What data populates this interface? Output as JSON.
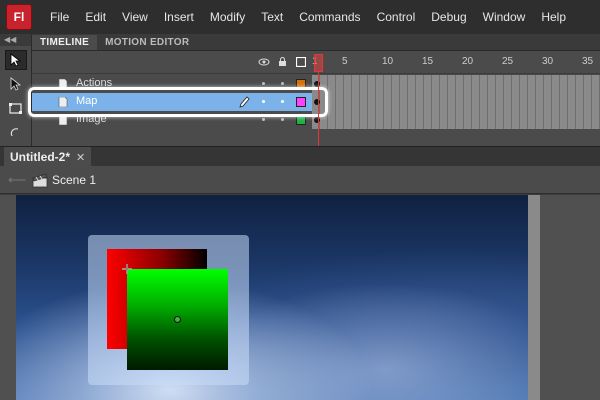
{
  "app": {
    "logo_text": "Fl"
  },
  "menu": [
    "File",
    "Edit",
    "View",
    "Insert",
    "Modify",
    "Text",
    "Commands",
    "Control",
    "Debug",
    "Window",
    "Help"
  ],
  "timeline": {
    "tabs": [
      {
        "label": "TIMELINE",
        "active": true
      },
      {
        "label": "MOTION EDITOR",
        "active": false
      }
    ],
    "frame_numbers": [
      "1",
      "5",
      "10",
      "15",
      "20",
      "25",
      "30",
      "35"
    ],
    "layers": [
      {
        "name": "Actions",
        "color": "#d4700a",
        "selected": false
      },
      {
        "name": "Map",
        "color": "#ff40ff",
        "selected": true
      },
      {
        "name": "Image",
        "color": "#20b040",
        "selected": false
      }
    ]
  },
  "document": {
    "tab_label": "Untitled-2*",
    "close_symbol": "✕"
  },
  "scene": {
    "label": "Scene 1"
  },
  "colors": {
    "selection": "#7bb2ea",
    "accent": "#c8232d"
  }
}
